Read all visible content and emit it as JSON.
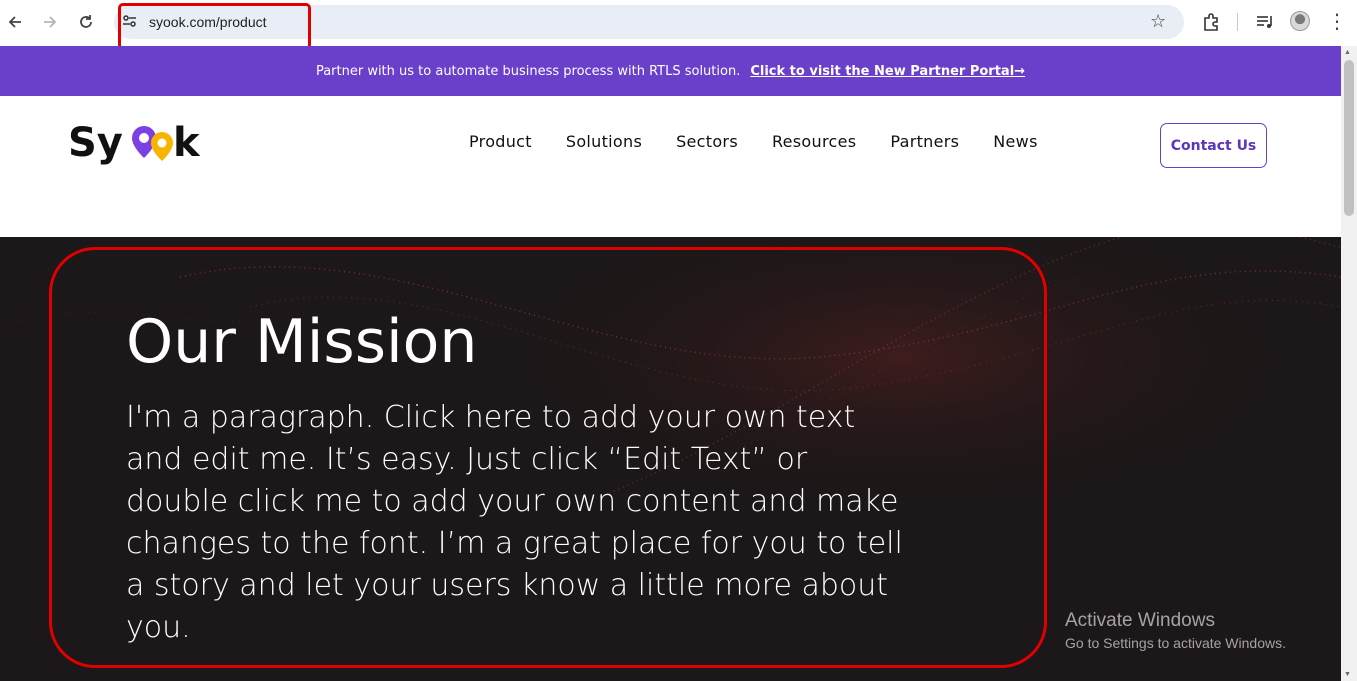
{
  "browser": {
    "url": "syook.com/product",
    "icons": {
      "back": "arrow-left-icon",
      "forward": "arrow-right-icon",
      "reload": "reload-icon",
      "site_info": "tune-icon",
      "bookmark": "star-icon",
      "extensions": "puzzle-icon",
      "media": "media-control-icon",
      "profile": "avatar",
      "menu": "kebab-menu-icon"
    }
  },
  "promo": {
    "text": "Partner with us to automate business process with RTLS solution.",
    "link": "Click to visit the New Partner Portal→"
  },
  "header": {
    "logo": "Syook",
    "nav": [
      "Product",
      "Solutions",
      "Sectors",
      "Resources",
      "Partners",
      "News"
    ],
    "contact": "Contact Us"
  },
  "hero": {
    "title": "Our Mission",
    "body": "I'm a paragraph. Click here to add your own text and edit me. It’s easy. Just click “Edit Text” or double click me to add your own content and make changes to the font. I’m a great place for you to tell a story and let your users know a little more about you."
  },
  "watermark": {
    "title": "Activate Windows",
    "subtitle": "Go to Settings to activate Windows."
  },
  "colors": {
    "promo_bg": "#6a3fc9",
    "hero_bg": "#1c1718",
    "highlight": "#e00000",
    "logo_purple": "#7b3fe4",
    "logo_yellow": "#f7b500"
  }
}
